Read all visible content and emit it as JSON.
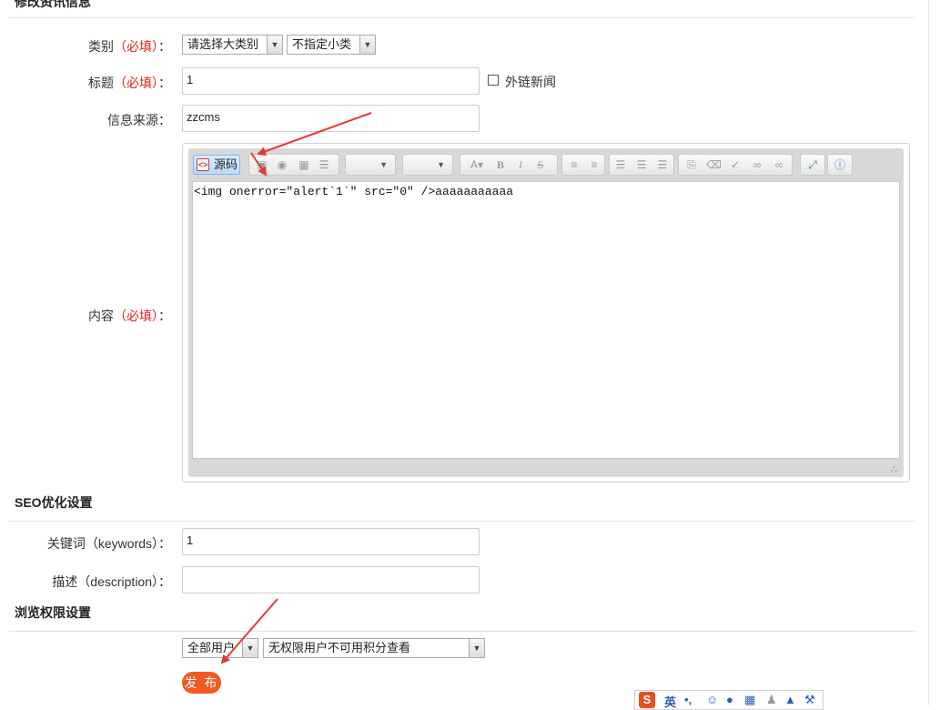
{
  "sections": {
    "info_title": "修改资讯信息",
    "seo_title": "SEO优化设置",
    "perm_title": "浏览权限设置"
  },
  "form": {
    "category": {
      "label": "类别",
      "required": "（必填）",
      "colon": "：",
      "major_selected": "请选择大类别",
      "minor_selected": "不指定小类"
    },
    "title": {
      "label": "标题",
      "required": "（必填）",
      "colon": "：",
      "value": "1",
      "external_link_label": "外链新闻"
    },
    "source": {
      "label": "信息来源：",
      "value": "zzcms"
    },
    "content": {
      "label": "内容",
      "required": "（必填）",
      "colon": "：",
      "source_button": "源码",
      "body": "<img onerror=\"alert`1`\" src=\"0\" />aaaaaaaaaaa"
    },
    "keywords": {
      "label": "关键词（keywords）：",
      "value": "1"
    },
    "description": {
      "label": "描述（description）：",
      "value": ""
    },
    "permission": {
      "group_selected": "全部用户",
      "rule_selected": "无权限用户不可用积分查看"
    },
    "publish_label": "发 布"
  },
  "ime": {
    "logo": "S",
    "mode": "英"
  },
  "colors": {
    "required": "#d9241c",
    "publish": "#f05a22",
    "arrow": "#e53935"
  }
}
